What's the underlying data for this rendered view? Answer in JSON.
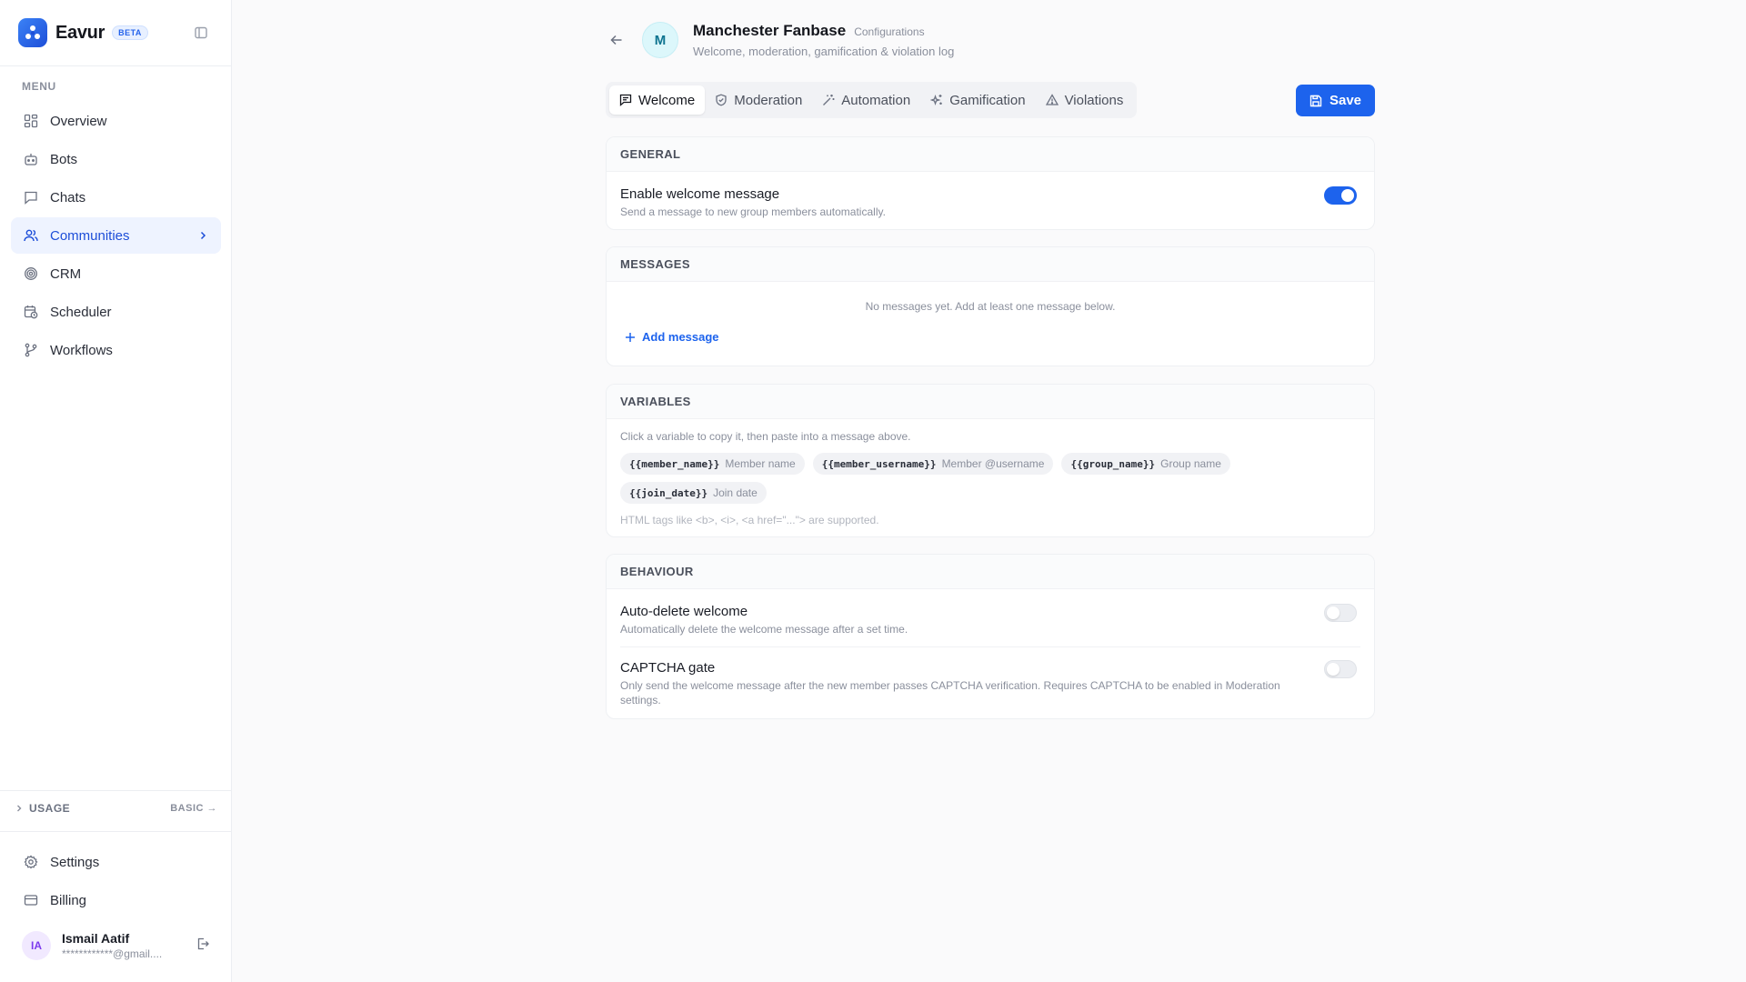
{
  "brand": {
    "name": "Eavur",
    "badge": "BETA"
  },
  "sidebar": {
    "menu_label": "MENU",
    "items": [
      {
        "label": "Overview",
        "icon": "grid-icon"
      },
      {
        "label": "Bots",
        "icon": "bot-icon"
      },
      {
        "label": "Chats",
        "icon": "chat-icon"
      },
      {
        "label": "Communities",
        "icon": "users-icon",
        "active": true
      },
      {
        "label": "CRM",
        "icon": "target-icon"
      },
      {
        "label": "Scheduler",
        "icon": "calendar-clock-icon"
      },
      {
        "label": "Workflows",
        "icon": "git-branch-icon"
      }
    ],
    "usage": {
      "label": "USAGE",
      "plan": "BASIC →"
    },
    "bottom_items": [
      {
        "label": "Settings",
        "icon": "gear-icon"
      },
      {
        "label": "Billing",
        "icon": "credit-card-icon"
      }
    ],
    "user": {
      "initials": "IA",
      "name": "Ismail Aatif",
      "email": "************@gmail...."
    }
  },
  "header": {
    "avatar_letter": "M",
    "title": "Manchester Fanbase",
    "badge": "Configurations",
    "description": "Welcome, moderation, gamification & violation log"
  },
  "tabs": [
    {
      "label": "Welcome",
      "icon": "message-square-icon",
      "active": true
    },
    {
      "label": "Moderation",
      "icon": "shield-icon"
    },
    {
      "label": "Automation",
      "icon": "wand-icon"
    },
    {
      "label": "Gamification",
      "icon": "sparkles-icon"
    },
    {
      "label": "Violations",
      "icon": "alert-triangle-icon"
    }
  ],
  "save_label": "Save",
  "general": {
    "heading": "GENERAL",
    "enable_title": "Enable welcome message",
    "enable_desc": "Send a message to new group members automatically.",
    "enabled": true
  },
  "messages": {
    "heading": "MESSAGES",
    "empty": "No messages yet. Add at least one message below.",
    "add_label": "Add message"
  },
  "variables": {
    "heading": "VARIABLES",
    "hint": "Click a variable to copy it, then paste into a message above.",
    "chips": [
      {
        "code": "{{member_name}}",
        "label": "Member name"
      },
      {
        "code": "{{member_username}}",
        "label": "Member @username"
      },
      {
        "code": "{{group_name}}",
        "label": "Group name"
      },
      {
        "code": "{{join_date}}",
        "label": "Join date"
      }
    ],
    "html_hint": "HTML tags like <b>, <i>, <a href=\"...\"> are supported."
  },
  "behaviour": {
    "heading": "BEHAVIOUR",
    "auto_delete_title": "Auto-delete welcome",
    "auto_delete_desc": "Automatically delete the welcome message after a set time.",
    "auto_delete_on": false,
    "captcha_title": "CAPTCHA gate",
    "captcha_desc": "Only send the welcome message after the new member passes CAPTCHA verification. Requires CAPTCHA to be enabled in Moderation settings.",
    "captcha_on": false
  },
  "colors": {
    "accent": "#1d63ed",
    "active_nav_bg": "#eef3ff"
  }
}
